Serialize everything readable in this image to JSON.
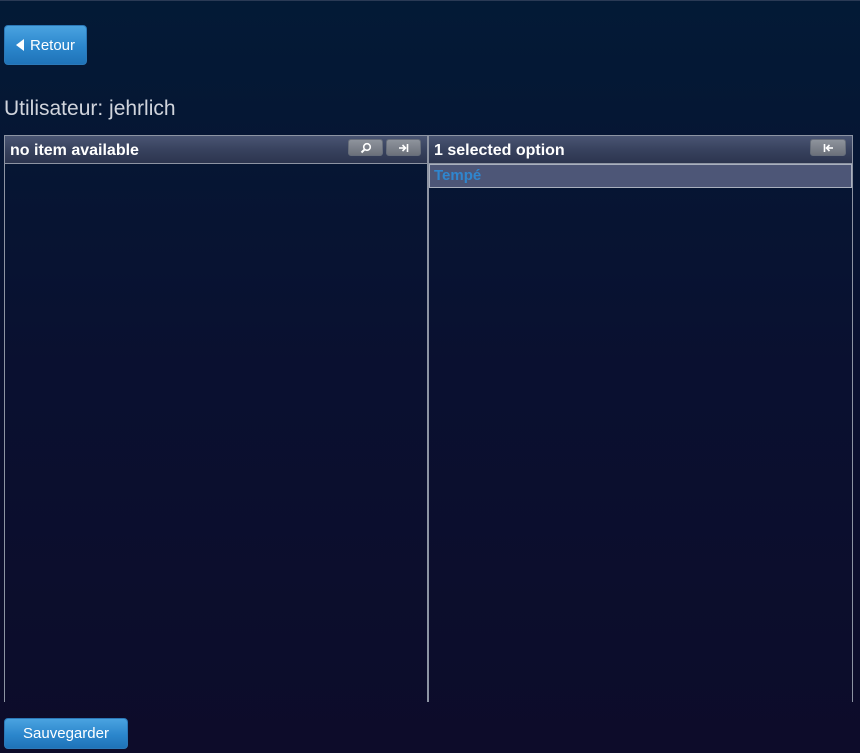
{
  "back_button": {
    "label": "Retour",
    "icon": "triangle-left-icon"
  },
  "user": {
    "title": "Utilisateur: jehrlich"
  },
  "available_panel": {
    "header": "no item available",
    "search_icon": "magnifier-icon",
    "add_all_icon": "arrow-right-bar-icon"
  },
  "selected_panel": {
    "header": "1 selected option",
    "remove_all_icon": "bar-arrow-left-icon",
    "items": [
      {
        "label": "Tempé"
      }
    ]
  },
  "save_button": {
    "label": "Sauvegarder"
  },
  "colors": {
    "button_blue": "#2b86cc",
    "selected_text": "#2f86cf",
    "selected_bg": "#4d5677"
  }
}
